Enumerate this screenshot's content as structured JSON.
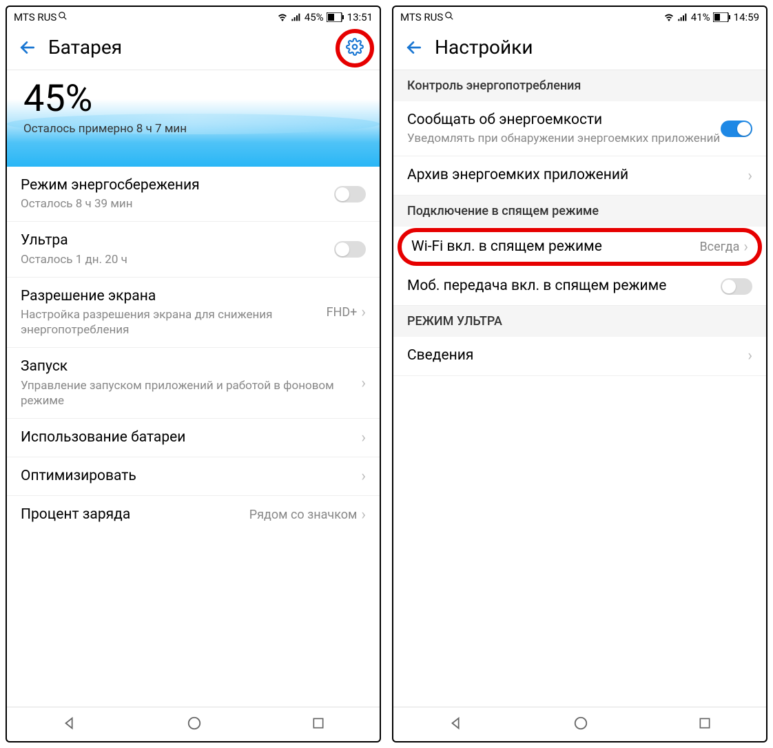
{
  "left": {
    "status": {
      "carrier": "MTS RUS",
      "battery_text": "45%",
      "time": "13:51"
    },
    "header": {
      "title": "Батарея"
    },
    "hero": {
      "percent": "45%",
      "remaining": "Осталось примерно 8 ч 7 мин"
    },
    "rows": {
      "power_save": {
        "title": "Режим энергосбережения",
        "sub": "Осталось 8 ч 39 мин"
      },
      "ultra": {
        "title": "Ультра",
        "sub": "Осталось 1 дн. 20 ч"
      },
      "resolution": {
        "title": "Разрешение экрана",
        "sub": "Настройка разрешения экрана для снижения энергопотребления",
        "value": "FHD+"
      },
      "launch": {
        "title": "Запуск",
        "sub": "Управление запуском приложений и работой в фоновом режиме"
      },
      "usage": {
        "title": "Использование батареи"
      },
      "optimize": {
        "title": "Оптимизировать"
      },
      "percent_row": {
        "title": "Процент заряда",
        "value": "Рядом со значком"
      }
    }
  },
  "right": {
    "status": {
      "carrier": "MTS RUS",
      "battery_text": "41%",
      "time": "14:59"
    },
    "header": {
      "title": "Настройки"
    },
    "sections": {
      "s1": "Контроль энергопотребления",
      "s2": "Подключение в спящем режиме",
      "s3": "РЕЖИМ УЛЬТРА"
    },
    "rows": {
      "notify": {
        "title": "Сообщать об энергоемкости",
        "sub": "Уведомлять при обнаружении энергоемких приложений"
      },
      "archive": {
        "title": "Архив энергоемких приложений"
      },
      "wifi": {
        "title": "Wi-Fi вкл. в спящем режиме",
        "value": "Всегда"
      },
      "mobile": {
        "title": "Моб. передача вкл. в спящем режиме"
      },
      "info": {
        "title": "Сведения"
      }
    }
  }
}
